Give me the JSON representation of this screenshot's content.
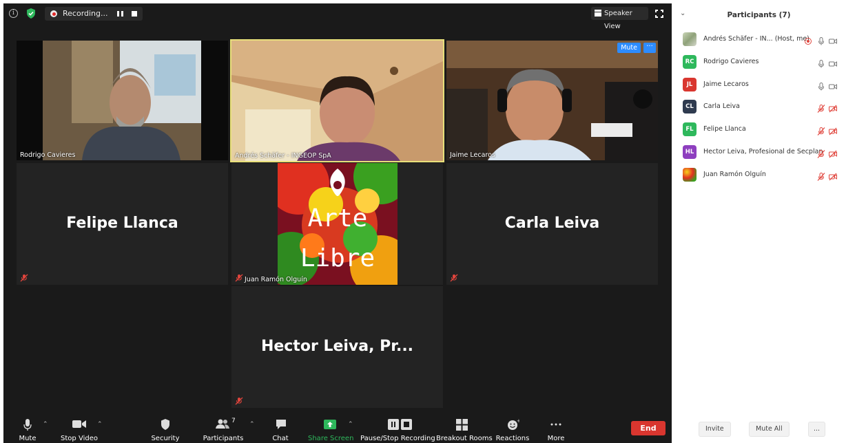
{
  "topbar": {
    "recording_label": "Recording...",
    "speaker_view_label": "Speaker View"
  },
  "tiles": {
    "rodrigo": {
      "name": "Rodrigo Cavieres"
    },
    "andres": {
      "name": "Andrés Schäfer - INGEOP SpA"
    },
    "jaime": {
      "name": "Jaime Lecaros",
      "mute_label": "Mute",
      "more_label": "···"
    },
    "felipe": {
      "big_name": "Felipe Llanca"
    },
    "juan": {
      "name": "Juan Ramón Olguín",
      "art_line1": "Arte",
      "art_line2": "Libre"
    },
    "carla": {
      "big_name": "Carla Leiva"
    },
    "hector": {
      "big_name": "Hector Leiva, Pr..."
    }
  },
  "toolbar": {
    "mute": "Mute",
    "stop_video": "Stop Video",
    "security": "Security",
    "participants": "Participants",
    "participants_count": "7",
    "chat": "Chat",
    "share_screen": "Share Screen",
    "pause_stop_recording": "Pause/Stop Recording",
    "breakout_rooms": "Breakout Rooms",
    "reactions": "Reactions",
    "more": "More",
    "end": "End"
  },
  "panel": {
    "title": "Participants (7)",
    "participants": [
      {
        "initials": "",
        "name": "Andrés Schäfer - IN... (Host, me)",
        "color": "#b9c7a8",
        "mic": "on",
        "cam": "on"
      },
      {
        "initials": "RC",
        "name": "Rodrigo Cavieres",
        "color": "#2eb85c",
        "mic": "on",
        "cam": "on"
      },
      {
        "initials": "JL",
        "name": "Jaime Lecaros",
        "color": "#d9362f",
        "mic": "on",
        "cam": "on"
      },
      {
        "initials": "CL",
        "name": "Carla Leiva",
        "color": "#2f3b4f",
        "mic": "off",
        "cam": "off"
      },
      {
        "initials": "FL",
        "name": "Felipe Llanca",
        "color": "#2eb85c",
        "mic": "off",
        "cam": "off"
      },
      {
        "initials": "HL",
        "name": "Hector Leiva, Profesional de Secplan",
        "color": "#8e3fbf",
        "mic": "off",
        "cam": "off"
      },
      {
        "initials": "",
        "name": "Juan Ramón Olguín",
        "color": "#d4a020",
        "mic": "off",
        "cam": "off"
      }
    ],
    "invite_label": "Invite",
    "mute_all_label": "Mute All",
    "more_label": "..."
  },
  "colors": {
    "accent_blue": "#2d8cff",
    "end_red": "#d9362f",
    "active_speaker": "#e8e07a",
    "share_green": "#2eb85c",
    "muted_red": "#e0443c"
  }
}
